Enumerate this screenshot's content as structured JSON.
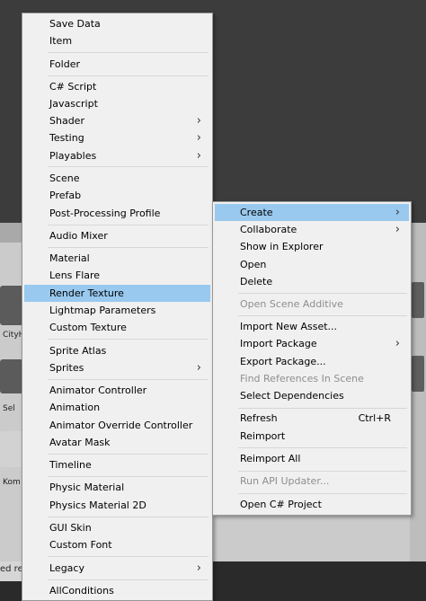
{
  "background": {
    "thumb_labels": [
      "CityH",
      "Sel",
      "Kom"
    ],
    "status_text": "ed re"
  },
  "main_menu": {
    "items": [
      {
        "label": "Save Data"
      },
      {
        "label": "Item"
      },
      {
        "label": "Folder"
      },
      {
        "label": "C# Script"
      },
      {
        "label": "Javascript"
      },
      {
        "label": "Shader",
        "submenu": true
      },
      {
        "label": "Testing",
        "submenu": true
      },
      {
        "label": "Playables",
        "submenu": true
      },
      {
        "label": "Scene"
      },
      {
        "label": "Prefab"
      },
      {
        "label": "Post-Processing Profile"
      },
      {
        "label": "Audio Mixer"
      },
      {
        "label": "Material"
      },
      {
        "label": "Lens Flare"
      },
      {
        "label": "Render Texture",
        "highlighted": true
      },
      {
        "label": "Lightmap Parameters"
      },
      {
        "label": "Custom Texture"
      },
      {
        "label": "Sprite Atlas"
      },
      {
        "label": "Sprites",
        "submenu": true
      },
      {
        "label": "Animator Controller"
      },
      {
        "label": "Animation"
      },
      {
        "label": "Animator Override Controller"
      },
      {
        "label": "Avatar Mask"
      },
      {
        "label": "Timeline"
      },
      {
        "label": "Physic Material"
      },
      {
        "label": "Physics Material 2D"
      },
      {
        "label": "GUI Skin"
      },
      {
        "label": "Custom Font"
      },
      {
        "label": "Legacy",
        "submenu": true
      },
      {
        "label": "AllConditions"
      }
    ],
    "arrow_glyph": "›"
  },
  "assets_menu": {
    "items": [
      {
        "label": "Create",
        "submenu": true,
        "highlighted": true
      },
      {
        "label": "Collaborate",
        "submenu": true
      },
      {
        "label": "Show in Explorer"
      },
      {
        "label": "Open"
      },
      {
        "label": "Delete"
      },
      {
        "label": "Open Scene Additive",
        "disabled": true
      },
      {
        "label": "Import New Asset..."
      },
      {
        "label": "Import Package",
        "submenu": true
      },
      {
        "label": "Export Package..."
      },
      {
        "label": "Find References In Scene",
        "disabled": true
      },
      {
        "label": "Select Dependencies"
      },
      {
        "label": "Refresh",
        "shortcut": "Ctrl+R"
      },
      {
        "label": "Reimport"
      },
      {
        "label": "Reimport All"
      },
      {
        "label": "Run API Updater...",
        "disabled": true
      },
      {
        "label": "Open C# Project"
      }
    ],
    "arrow_glyph": "›"
  },
  "colors": {
    "menu_bg": "#f0f0f0",
    "highlight": "#99c9ef",
    "disabled_text": "#8e8e8e"
  }
}
